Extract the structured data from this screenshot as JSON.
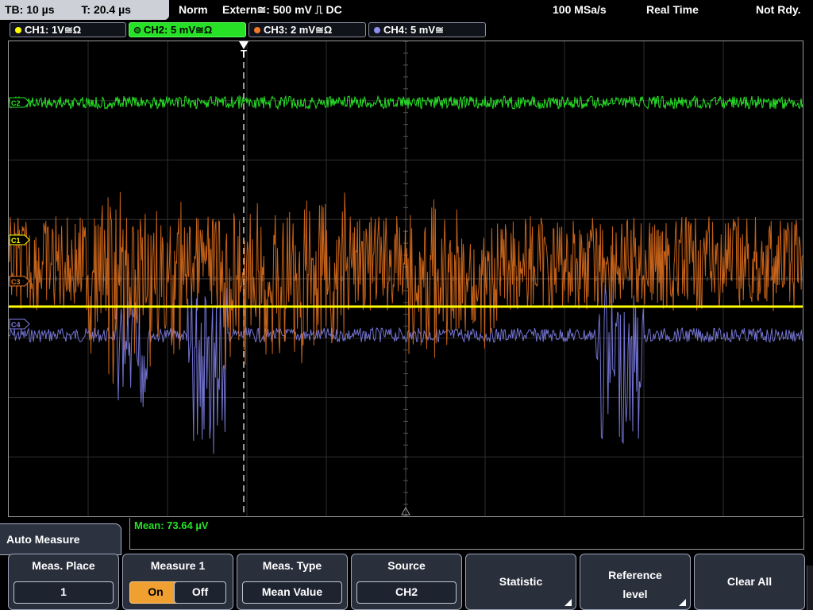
{
  "top": {
    "timebase": "TB: 10 µs",
    "trigger_time": "T: 20.4 µs",
    "mode": "Norm",
    "trigger_source": "Extern≅: 500 mV ⎍ DC",
    "sample_rate": "100 MSa/s",
    "acq_mode": "Real Time",
    "status": "Not Rdy."
  },
  "channels": [
    {
      "label": "CH1: 1V≅Ω",
      "color": "#ffff00"
    },
    {
      "label": "CH2: 5 mV≅Ω",
      "color": "#27e127"
    },
    {
      "label": "CH3: 2 mV≅Ω",
      "color": "#f07a28"
    },
    {
      "label": "CH4: 5 mV≅",
      "color": "#8f8ff0"
    }
  ],
  "markers": {
    "c2": "C2",
    "c1": "C1",
    "c3": "C3",
    "c4": "C4",
    "trigger": "T"
  },
  "measurement": {
    "result": "Mean: 73.64 µV"
  },
  "menu": {
    "title": "Auto Measure",
    "meas_place": {
      "label": "Meas. Place",
      "value": "1"
    },
    "measure1": {
      "label": "Measure 1",
      "on": "On",
      "off": "Off"
    },
    "meas_type": {
      "label": "Meas. Type",
      "value": "Mean Value"
    },
    "source": {
      "label": "Source",
      "value": "CH2"
    },
    "statistic": {
      "label": "Statistic"
    },
    "reference": {
      "label_line1": "Reference",
      "label_line2": "level"
    },
    "clear_all": {
      "label": "Clear All"
    }
  },
  "colors": {
    "ch1": "#ffff00",
    "ch2": "#27e127",
    "ch3": "#e8731f",
    "ch4": "#8080e8",
    "grid": "#3a3a3a",
    "menu_bg": "#2a2f3c",
    "active_button": "#f0a030"
  }
}
